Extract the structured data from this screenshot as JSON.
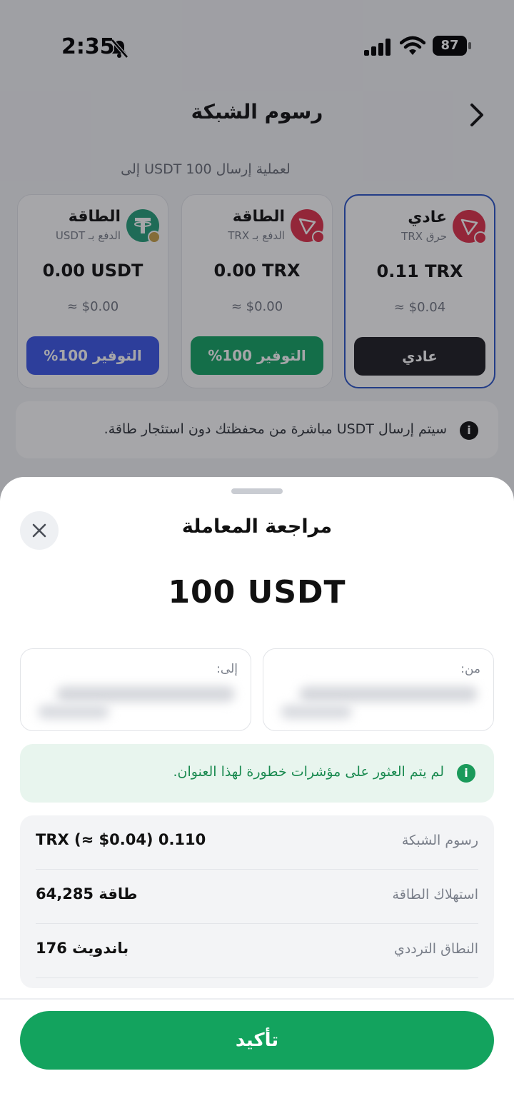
{
  "status_bar": {
    "time": "2:35",
    "battery": "87"
  },
  "background": {
    "title": "رسوم الشبكة",
    "subtitle": "لعملية إرسال USDT 100 إلى",
    "cards": [
      {
        "title": "عادي",
        "sub": "حرق TRX",
        "amount": "0.11 TRX",
        "usd": "$0.04 ≈",
        "button": "عادي",
        "button_color": "#1d1d22",
        "logo_color": "#e0314b"
      },
      {
        "title": "الطاقة",
        "sub": "الدفع بـ TRX",
        "amount": "0.00 TRX",
        "usd": "$0.00 ≈",
        "button": "التوفير 100%",
        "button_color": "#14a564",
        "logo_color": "#e0314b"
      },
      {
        "title": "الطاقة",
        "sub": "الدفع بـ USDT",
        "amount": "0.00 USDT",
        "usd": "$0.00 ≈",
        "button": "التوفير 100%",
        "button_color": "#3d58e8",
        "logo_color": "#26a17b"
      }
    ],
    "info_text": "سيتم إرسال USDT مباشرة من محفظتك دون استئجار طاقة."
  },
  "sheet": {
    "title": "مراجعة المعاملة",
    "amount": "100 USDT",
    "from_label": "من:",
    "to_label": "إلى:",
    "risk_text": "لم يتم العثور على مؤشرات خطورة لهذا العنوان.",
    "details": [
      {
        "label": "رسوم الشبكة",
        "value": "TRX (≈ $0.04) 0.110"
      },
      {
        "label": "استهلاك الطاقة",
        "value": "64,285 طاقة"
      },
      {
        "label": "النطاق الترددي",
        "value": "176 باندويث"
      }
    ],
    "confirm_label": "تأكيد"
  },
  "colors": {
    "accent_green": "#13a35e",
    "selected_border": "#2c56c9"
  }
}
